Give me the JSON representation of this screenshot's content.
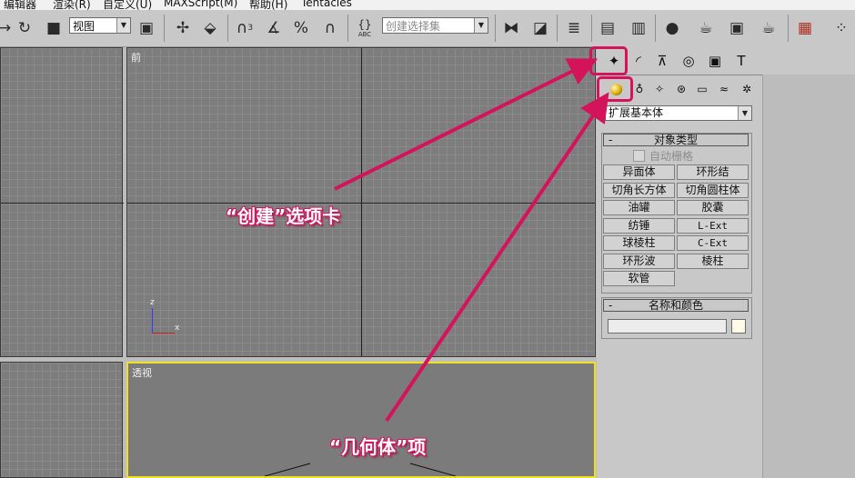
{
  "menu": {
    "items": [
      "编辑器",
      "渲染(R)",
      "自定义(U)",
      "MAXScript(M)",
      "帮助(H)",
      "Tentacles"
    ]
  },
  "toolbar": {
    "view_combo": "视图",
    "selection_set_placeholder": "创建选择集",
    "snap_label": "3",
    "abc_label": "ABC"
  },
  "viewports": {
    "front_label": "前",
    "perspective_label": "透视",
    "axis_z": "z",
    "axis_x": "x"
  },
  "command_panel": {
    "category_dropdown": "扩展基本体",
    "object_type_header": "对象类型",
    "auto_grid_label": "自动栅格",
    "object_buttons": [
      "异面体",
      "环形结",
      "切角长方体",
      "切角圆柱体",
      "油罐",
      "胶囊",
      "纺锤",
      "L-Ext",
      "球棱柱",
      "C-Ext",
      "环形波",
      "棱柱",
      "软管"
    ],
    "name_color_header": "名称和颜色",
    "name_value": "",
    "swatch_color": "#fffbe6"
  },
  "annotations": {
    "create_tab": "“创建”选项卡",
    "geometry": "“几何体”项",
    "color": "#d4145a"
  }
}
